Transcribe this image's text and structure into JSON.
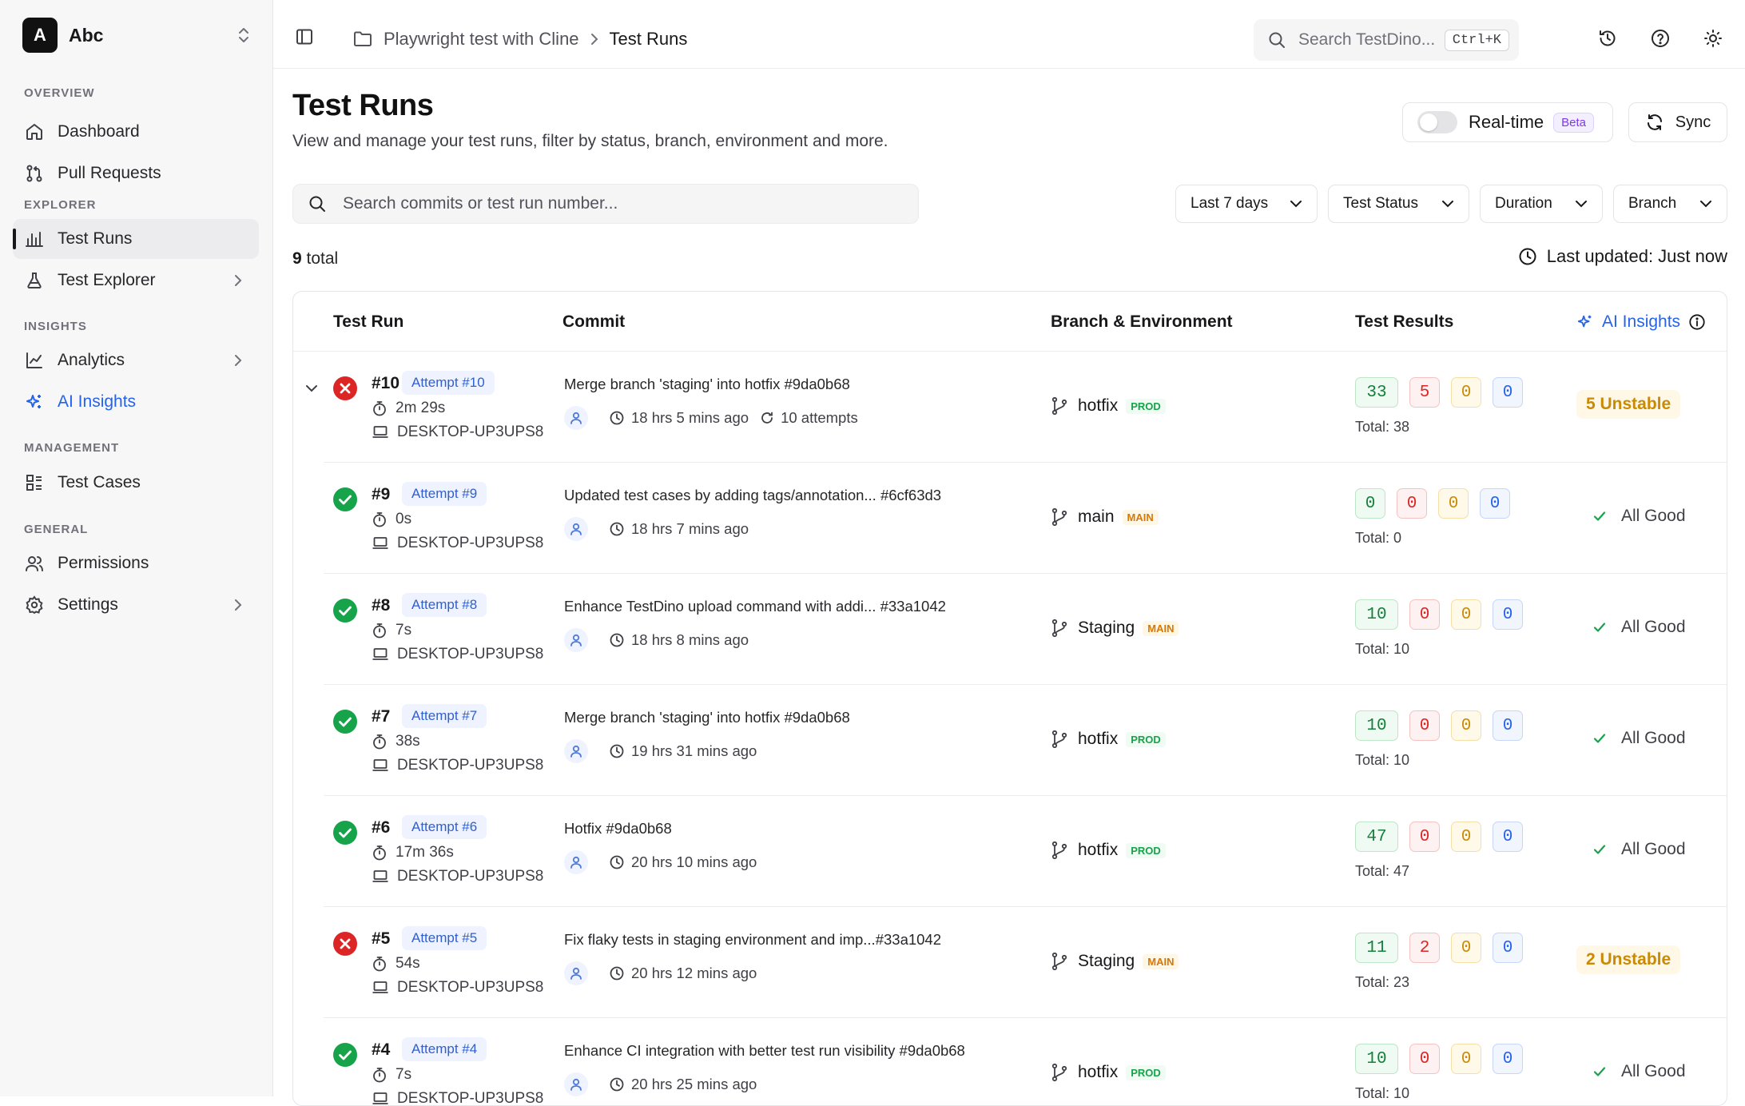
{
  "workspace": {
    "initial": "A",
    "name": "Abc"
  },
  "sidebar": {
    "sections": [
      {
        "label": "OVERVIEW",
        "items": [
          {
            "label": "Dashboard",
            "icon": "home-icon"
          },
          {
            "label": "Pull Requests",
            "icon": "git-pull-request-icon"
          }
        ]
      },
      {
        "label": "EXPLORER",
        "items": [
          {
            "label": "Test Runs",
            "icon": "bar-chart-icon",
            "active": true
          },
          {
            "label": "Test Explorer",
            "icon": "flask-icon",
            "chevron": true
          }
        ]
      },
      {
        "label": "INSIGHTS",
        "items": [
          {
            "label": "Analytics",
            "icon": "line-chart-icon",
            "chevron": true
          },
          {
            "label": "AI Insights",
            "icon": "sparkles-icon"
          }
        ]
      },
      {
        "label": "MANAGEMENT",
        "items": [
          {
            "label": "Test Cases",
            "icon": "list-checks-icon"
          }
        ]
      },
      {
        "label": "GENERAL",
        "items": [
          {
            "label": "Permissions",
            "icon": "users-icon"
          },
          {
            "label": "Settings",
            "icon": "gear-icon",
            "chevron": true
          }
        ]
      }
    ]
  },
  "topbar": {
    "project": "Playwright test with Cline",
    "current": "Test Runs",
    "search_placeholder": "Search TestDino...",
    "shortcut": "Ctrl+K"
  },
  "page": {
    "title": "Test Runs",
    "subtitle": "View and manage your test runs, filter by status, branch, environment and more.",
    "realtime_label": "Real-time",
    "realtime_on": false,
    "beta_label": "Beta",
    "sync_label": "Sync",
    "search_placeholder": "Search commits or test run number...",
    "filters": [
      "Last 7 days",
      "Test Status",
      "Duration",
      "Branch"
    ],
    "total_count": "9",
    "total_label": "total",
    "last_updated": "Last updated: Just now"
  },
  "table": {
    "headers": {
      "run": "Test Run",
      "commit": "Commit",
      "branch": "Branch & Environment",
      "results": "Test Results",
      "insights": "AI Insights"
    },
    "rows": [
      {
        "status": "failed",
        "expanded": true,
        "number": "#10",
        "attempt": "Attempt #10",
        "duration": "2m 29s",
        "host": "DESKTOP-UP3UPS8",
        "commit": "Merge branch 'staging' into hotfix #9da0b68",
        "ago": "18 hrs 5 mins ago",
        "attempts": "10 attempts",
        "branch": "hotfix",
        "env": "PROD",
        "passed": "33",
        "failed": "5",
        "flaky": "0",
        "skipped": "0",
        "total": "Total: 38",
        "insight": "5 Unstable"
      },
      {
        "status": "passed",
        "number": "#9",
        "attempt": "Attempt #9",
        "duration": "0s",
        "host": "DESKTOP-UP3UPS8",
        "commit": "Updated test cases by adding tags/annotation... #6cf63d3",
        "ago": "18 hrs 7 mins ago",
        "branch": "main",
        "env": "MAIN",
        "passed": "0",
        "failed": "0",
        "flaky": "0",
        "skipped": "0",
        "total": "Total: 0",
        "insight": "All Good"
      },
      {
        "status": "passed",
        "number": "#8",
        "attempt": "Attempt #8",
        "duration": "7s",
        "host": "DESKTOP-UP3UPS8",
        "commit": "Enhance TestDino upload command with addi... #33a1042",
        "ago": "18 hrs 8 mins ago",
        "branch": "Staging",
        "env": "MAIN",
        "passed": "10",
        "failed": "0",
        "flaky": "0",
        "skipped": "0",
        "total": "Total: 10",
        "insight": "All Good"
      },
      {
        "status": "passed",
        "number": "#7",
        "attempt": "Attempt #7",
        "duration": "38s",
        "host": "DESKTOP-UP3UPS8",
        "commit": "Merge branch 'staging' into hotfix #9da0b68",
        "ago": "19 hrs 31 mins ago",
        "branch": "hotfix",
        "env": "PROD",
        "passed": "10",
        "failed": "0",
        "flaky": "0",
        "skipped": "0",
        "total": "Total: 10",
        "insight": "All Good"
      },
      {
        "status": "passed",
        "number": "#6",
        "attempt": "Attempt #6",
        "duration": "17m 36s",
        "host": "DESKTOP-UP3UPS8",
        "commit": "Hotfix #9da0b68",
        "ago": "20 hrs 10 mins ago",
        "branch": "hotfix",
        "env": "PROD",
        "passed": "47",
        "failed": "0",
        "flaky": "0",
        "skipped": "0",
        "total": "Total: 47",
        "insight": "All Good"
      },
      {
        "status": "failed",
        "number": "#5",
        "attempt": "Attempt #5",
        "duration": "54s",
        "host": "DESKTOP-UP3UPS8",
        "commit": "Fix flaky tests in staging environment and imp...#33a1042",
        "ago": "20 hrs 12 mins ago",
        "branch": "Staging",
        "env": "MAIN",
        "passed": "11",
        "failed": "2",
        "flaky": "0",
        "skipped": "0",
        "total": "Total: 23",
        "insight": "2 Unstable"
      },
      {
        "status": "passed",
        "number": "#4",
        "attempt": "Attempt #4",
        "duration": "7s",
        "host": "DESKTOP-UP3UPS8",
        "commit": "Enhance CI integration with better test run visibility #9da0b68",
        "ago": "20 hrs 25 mins ago",
        "branch": "hotfix",
        "env": "PROD",
        "passed": "10",
        "failed": "0",
        "flaky": "0",
        "skipped": "0",
        "total": "Total: 10",
        "insight": "All Good"
      }
    ]
  },
  "colors": {
    "accent": "#2563eb",
    "passed": "#16a34a",
    "failed": "#dc2626",
    "flaky": "#c98a07"
  }
}
